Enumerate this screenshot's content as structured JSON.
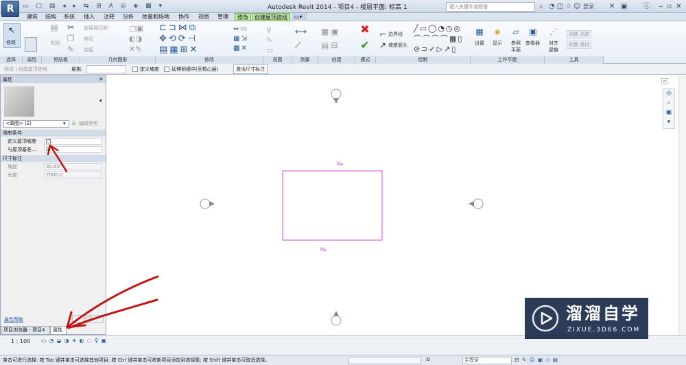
{
  "app": {
    "logo": "R",
    "title": "Autodesk Revit 2014 -  项目4 - 楼层平面: 标高 1",
    "search_placeholder": "键入关键字或短语",
    "login": "登录"
  },
  "tabs": [
    "建筑",
    "结构",
    "系统",
    "插入",
    "注释",
    "分析",
    "体量和场地",
    "协作",
    "视图",
    "管理",
    "修改",
    "创建屋顶迹线"
  ],
  "ribbon": {
    "modify": "修改",
    "paste": "粘贴",
    "clipboard_items": [
      "连接端切割",
      "剪切",
      "连接"
    ],
    "boundary_line": "边界线",
    "slope_arrow": "坡度箭头",
    "set": "设置",
    "show": "显示",
    "ref_plane": "参照平面",
    "viewer": "查看器",
    "align_eave": "对齐屋檐",
    "adjust_height": "调整 高度",
    "adjust_overhang": "调整 悬挑",
    "groups": [
      "选择",
      "属性",
      "剪贴板",
      "几何图形",
      "修改",
      "视图",
      "测量",
      "创建",
      "模式",
      "绘制",
      "工作平面",
      "工具"
    ]
  },
  "options_bar": {
    "context": "修改 | 创建屋顶迹线",
    "overhang_label": "悬挑:",
    "define_slope": "定义坡度",
    "extend_to_core": "延伸到墙中(至核心层)",
    "activate_dim": "激活尺寸标注"
  },
  "properties": {
    "title": "属性",
    "type_selector": "<草图> (2)",
    "edit_type": "编辑类型",
    "section_constraints": "限制条件",
    "define_roof_slope": "定义屋顶坡度",
    "offset_base": "与屋顶基准...",
    "offset_base_value": "0.",
    "section_dimensions": "尺寸标注",
    "slope": "坡度",
    "slope_value": "30.00°",
    "length": "长度",
    "length_value": "7000.0",
    "help": "属性帮助",
    "apply": "应用",
    "tab_browser": "项目浏览器 - 项目4",
    "tab_props": "属性"
  },
  "status": {
    "scale": "1 : 100",
    "hint": "单击可进行选择; 按 Tab 键并单击可选择其他项目; 按 Ctrl 键并单击可将新项目添加到选择集; 按 Shift 键并单击可取消选择。",
    "selection_count": ":0",
    "model": "主模型"
  },
  "watermark": {
    "name": "溜溜自学",
    "site": "ZIXUE.3D66.COM"
  },
  "colors": {
    "sketch_magenta": "#d24bd2",
    "ribbon_bg": "#e7eef6",
    "ctx_tab": "#b9e69f",
    "annotation_red": "#c41414"
  }
}
